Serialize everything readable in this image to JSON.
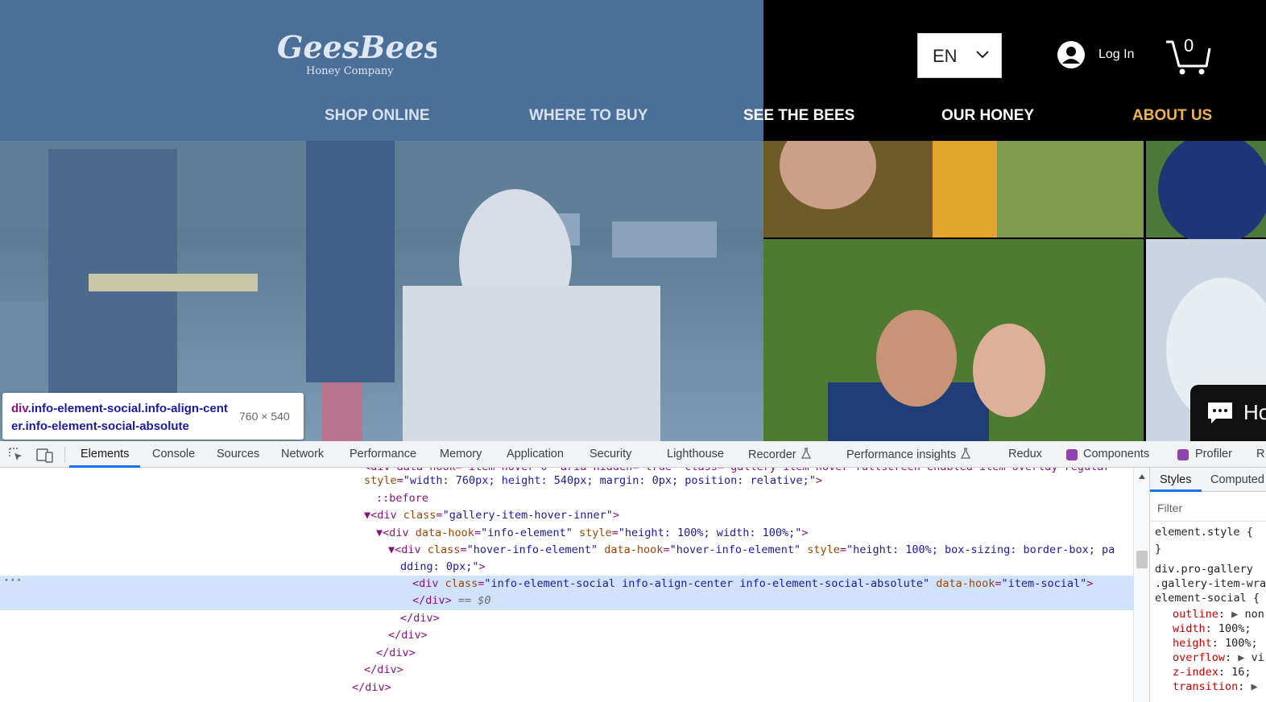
{
  "site": {
    "logo_main": "GeesBees",
    "logo_sub": "Honey Company",
    "language": "EN",
    "login_label": "Log In",
    "cart_count": "0",
    "nav": [
      "SHOP ONLINE",
      "WHERE TO BUY",
      "SEE THE BEES",
      "OUR HONEY",
      "ABOUT US"
    ],
    "nav_active_color": "#f2b34a",
    "header_color": "#4a6f98",
    "chat_label": "Ho"
  },
  "tooltip": {
    "tag": "div",
    "classes": ".info-element-social.info-align-center.info-element-social-absolute",
    "dimensions": "760 × 540"
  },
  "devtools": {
    "tabs": [
      "Elements",
      "Console",
      "Sources",
      "Network",
      "Performance",
      "Memory",
      "Application",
      "Security",
      "Lighthouse",
      "Recorder",
      "Performance insights",
      "Redux",
      "Components",
      "Profiler",
      "R"
    ],
    "active_tab": "Elements",
    "code": {
      "l0": "<div data-hook=\"item-hover-0\" aria-hidden=\"true\" class=\"gallery-item-hover fullscreen-enabled item-overlay-regular\"",
      "l1_attr": "style",
      "l1_val": "\"width: 760px; height: 540px; margin: 0px; position: relative;\"",
      "l2": "::before",
      "l3_class": "\"gallery-item-hover-inner\"",
      "l4_hook": "\"info-element\"",
      "l4_style": "\"height: 100%; width: 100%;\"",
      "l5_class": "\"hover-info-element\"",
      "l5_hook": "\"hover-info-element\"",
      "l5_style": "\"height: 100%; box-sizing: border-box; pa",
      "l6": "dding: 0px;\"",
      "l7_class": "\"info-element-social info-align-center info-element-social-absolute\"",
      "l7_hook": "\"item-social\"",
      "l8_tag": "</div>",
      "l8_note": "== $0",
      "close_tag": "</div>"
    },
    "styles_panel": {
      "tabs": [
        "Styles",
        "Computed"
      ],
      "filter_placeholder": "Filter",
      "element_style": "element.style {",
      "close_brace": "}",
      "selector1": "div.pro-gallery",
      "selector2": ".gallery-item-wra",
      "selector3": "element-social {",
      "props": [
        {
          "name": "outline",
          "value": "non"
        },
        {
          "name": "width",
          "value": "100%;"
        },
        {
          "name": "height",
          "value": "100%;"
        },
        {
          "name": "overflow",
          "value": "vi"
        },
        {
          "name": "z-index",
          "value": "16;"
        },
        {
          "name": "transition",
          "value": ""
        }
      ]
    }
  }
}
